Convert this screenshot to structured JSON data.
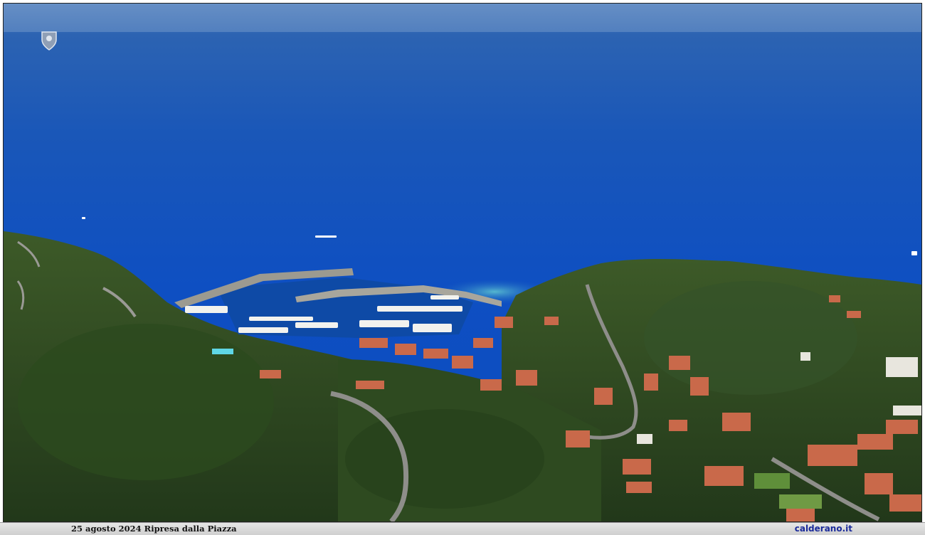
{
  "photo": {
    "subject": "aerial-harbor-coastline",
    "colors": {
      "sky": "#3a6fb0",
      "sea_far": "#1f5fb8",
      "sea_near": "#0d4fc4",
      "shallow": "#3fa0c8",
      "forest_dark": "#1f3a18",
      "forest_mid": "#3b5a26",
      "roof": "#c9694a",
      "road": "#8c8c88"
    }
  },
  "caption": {
    "left_text": "25 agosto 2024 Ripresa dalla Piazza",
    "right_text": "calderano.it"
  },
  "watermark": {
    "icon": "crest-emblem-icon"
  }
}
